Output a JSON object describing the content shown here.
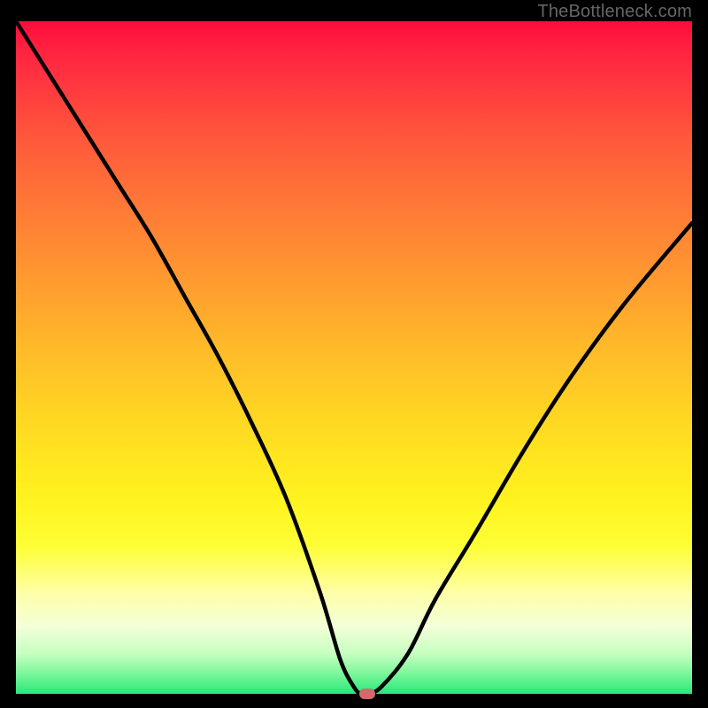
{
  "watermark": "TheBottleneck.com",
  "colors": {
    "frame": "#000000",
    "curve": "#000000",
    "marker": "#d7676f",
    "text": "#666666"
  },
  "chart_data": {
    "type": "line",
    "title": "",
    "xlabel": "",
    "ylabel": "",
    "xlim": [
      0,
      100
    ],
    "ylim": [
      0,
      100
    ],
    "grid": false,
    "legend": false,
    "background": "vertical-gradient red→orange→yellow→green (top→bottom)",
    "series": [
      {
        "name": "bottleneck-curve",
        "x": [
          0,
          5,
          10,
          15,
          20,
          25,
          30,
          35,
          40,
          45,
          48,
          50,
          51,
          52,
          54,
          58,
          62,
          68,
          75,
          82,
          90,
          100
        ],
        "y": [
          100,
          92,
          84,
          76,
          68,
          59,
          50,
          40,
          29,
          15,
          5,
          1,
          0,
          0,
          1,
          6,
          14,
          24,
          36,
          47,
          58,
          70
        ]
      }
    ],
    "marker": {
      "x": 52,
      "y": 0
    },
    "notes": "Y-axis inverted visually (0 at bottom, 100 at top). Curve minimum near x≈52. Values estimated from pixel positions; no axis ticks or labels present."
  }
}
